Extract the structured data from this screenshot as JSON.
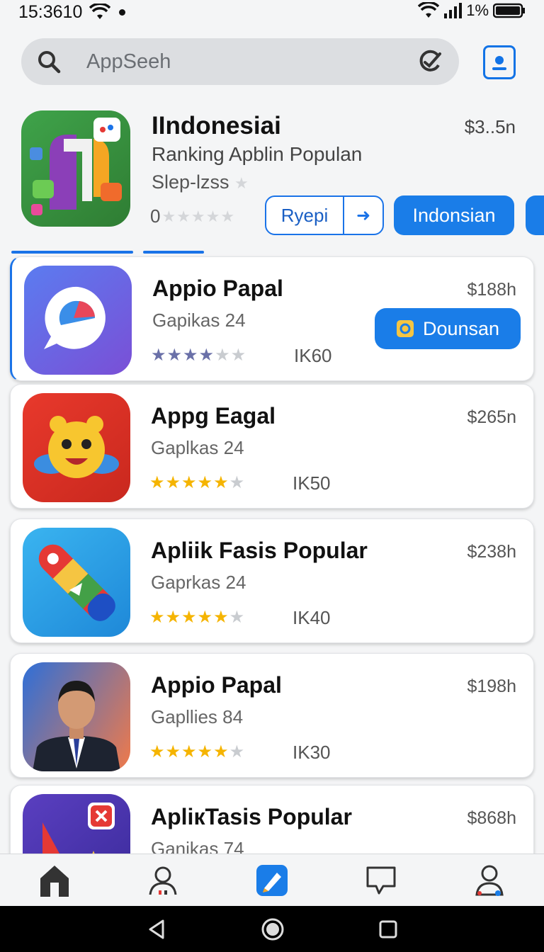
{
  "status": {
    "time": "15:3610",
    "battery": "1%"
  },
  "search": {
    "placeholder": "AppSeeh"
  },
  "featured": {
    "title": "IIndonesiai",
    "subtitle": "Ranking Apblin Populan",
    "subtitle2": "Slep-lzss",
    "price": "$3..5n",
    "rating_value": "0",
    "buttons": {
      "ryepi": "Ryepi",
      "indonesian": "Indonsian"
    }
  },
  "apps": [
    {
      "name": "Appio Papal",
      "category": "Gapikas 24",
      "price": "$188h",
      "rating": 3.5,
      "count": "IK60",
      "action": "Dounsan"
    },
    {
      "name": "Appg Eagal",
      "category": "Gaplkas 24",
      "price": "$265n",
      "rating": 4.5,
      "count": "IK50"
    },
    {
      "name": "Apliik Fasis Popular",
      "category": "Gaprkas 24",
      "price": "$238h",
      "rating": 4.5,
      "count": "IK40"
    },
    {
      "name": "Appio Papal",
      "category": "Gapllies 84",
      "price": "$198h",
      "rating": 4.5,
      "count": "IK30"
    },
    {
      "name": "ApliкTasis Popular",
      "category": "Ganikas 74",
      "price": "$868h",
      "rating": 0,
      "count": ""
    }
  ],
  "colors": {
    "accent": "#1a7de8",
    "star": "#f5b400"
  },
  "nav": [
    "home-icon",
    "people-icon",
    "apps-icon",
    "chat-icon",
    "profile-icon"
  ]
}
